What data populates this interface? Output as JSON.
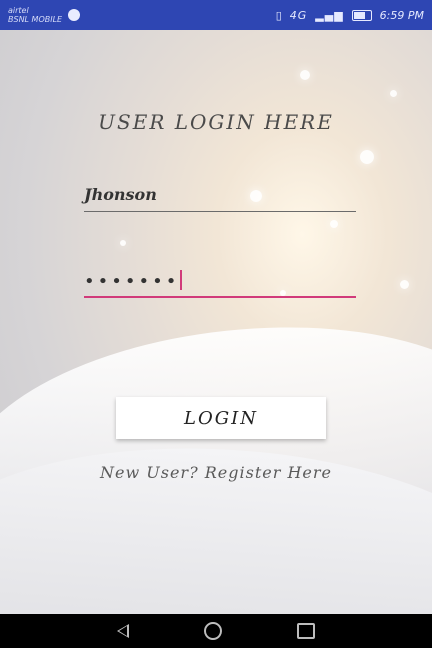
{
  "status_bar": {
    "carrier_line1": "airtel",
    "carrier_line2": "BSNL MOBILE",
    "network": "4G",
    "time": "6:59 PM",
    "bg_color": "#2e46b3"
  },
  "login": {
    "title": "USER LOGIN HERE",
    "username_value": "Jhonson",
    "password_value": "•••••••",
    "button_label": "LOGIN",
    "register_link": "New User? Register Here",
    "accent_color": "#d13a7a"
  },
  "navbar": {
    "icons": [
      "back-icon",
      "home-icon",
      "recents-icon"
    ]
  }
}
